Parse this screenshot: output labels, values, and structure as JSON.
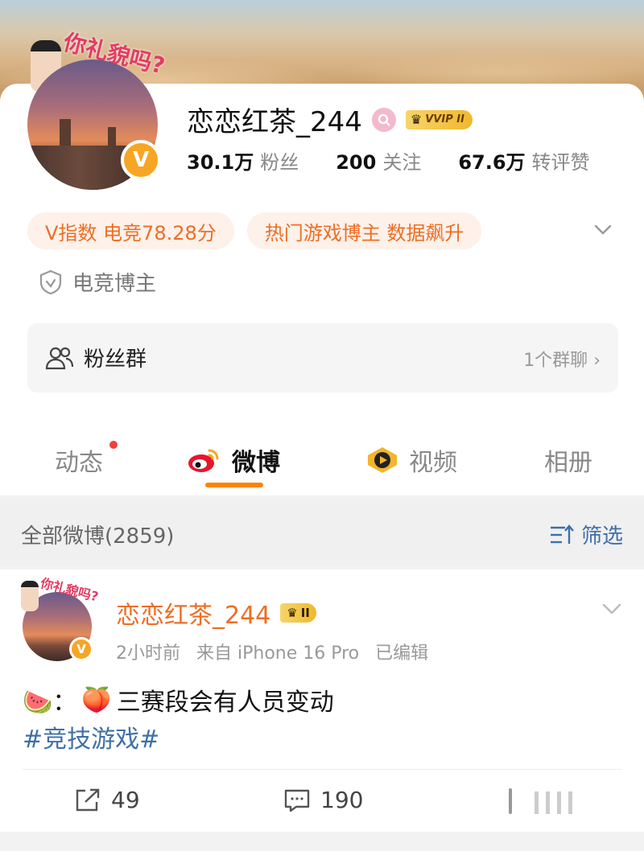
{
  "profile": {
    "username": "恋恋红茶_244",
    "vip_label": "VVIP II",
    "deco_text": "你礼貌吗?",
    "verified_mark": "V",
    "stats": [
      {
        "num": "30.1万",
        "label": "粉丝"
      },
      {
        "num": "200",
        "label": "关注"
      },
      {
        "num": "67.6万",
        "label": "转评赞"
      }
    ],
    "tags": [
      "V指数 电竞78.28分",
      "热门游戏博主 数据飙升"
    ],
    "certification": "电竞博主",
    "fans_group": {
      "label": "粉丝群",
      "right": "1个群聊"
    }
  },
  "tabs": [
    {
      "label": "动态",
      "has_dot": true
    },
    {
      "label": "微博",
      "active": true
    },
    {
      "label": "视频"
    },
    {
      "label": "相册"
    }
  ],
  "filter": {
    "left": "全部微博(2859)",
    "right": "筛选"
  },
  "post": {
    "author": "恋恋红茶_244",
    "vip_label": "II",
    "deco_text": "你礼貌吗?",
    "time": "2小时前",
    "source": "来自 iPhone 16 Pro",
    "edited": "已编辑",
    "text_prefix": "🍉：",
    "text_emoji": "🍑",
    "text_body": "三赛段会有人员变动",
    "hashtag": "#竞技游戏#",
    "reposts": "49",
    "comments": "190"
  },
  "colors": {
    "accent": "#ff8200",
    "tag_text": "#ee6e24",
    "link": "#3e6fa8",
    "verified": "#f7a623"
  },
  "icons": [
    "v-verified-icon",
    "female-icon",
    "crown-icon",
    "shield-icon",
    "group-icon",
    "chevron-down-icon",
    "chevron-right-icon",
    "weibo-logo-icon",
    "video-icon",
    "filter-icon",
    "repost-icon",
    "comment-icon"
  ]
}
